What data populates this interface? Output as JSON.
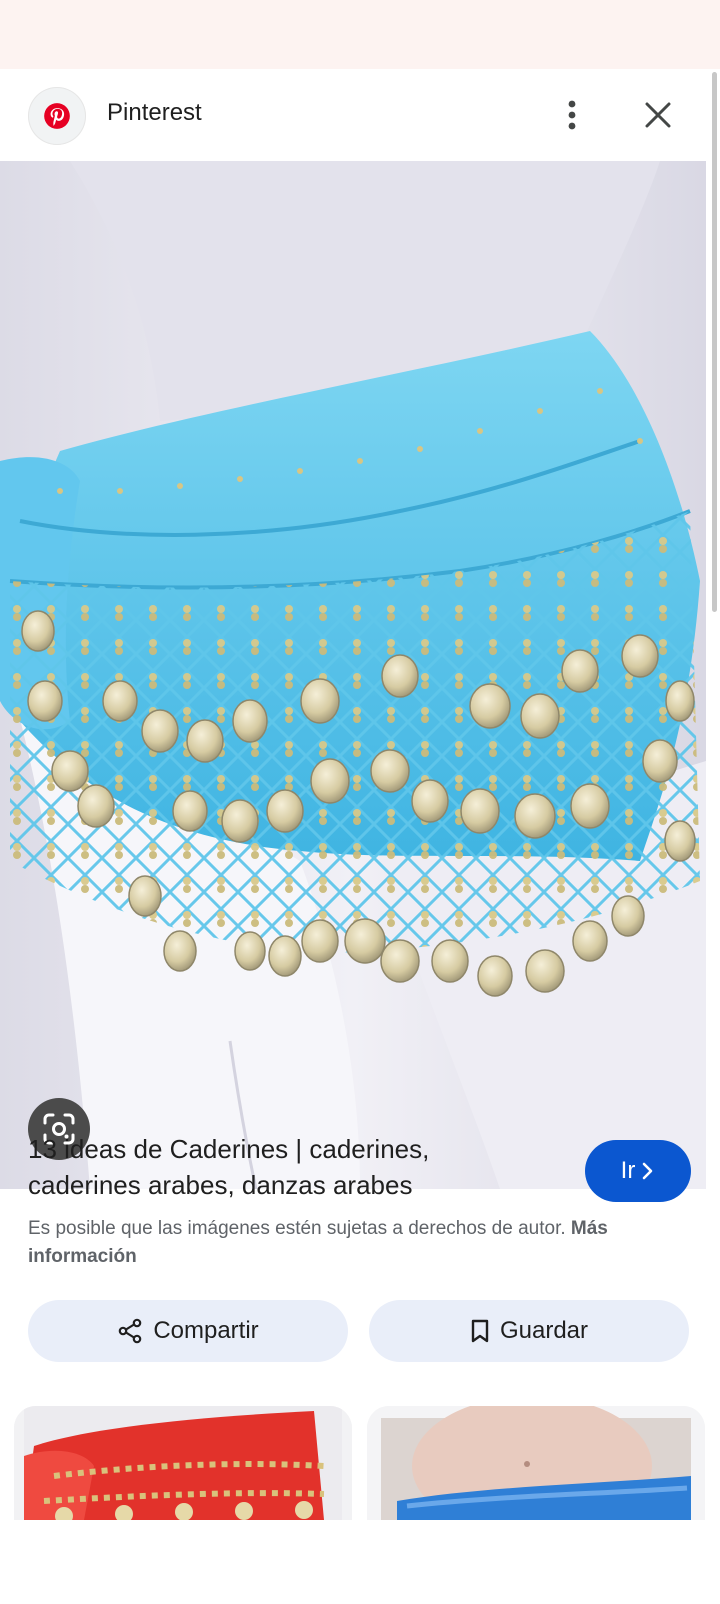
{
  "header": {
    "source_name": "Pinterest",
    "logo_icon": "pinterest-logo-icon",
    "menu_icon": "more-vert-icon",
    "close_icon": "close-icon"
  },
  "hero": {
    "lens_icon": "google-lens-icon"
  },
  "result": {
    "title": "13 ideas de Caderines | caderines, caderines arabes, danzas arabes",
    "go_label": "Ir",
    "notice_text": "Es posible que las imágenes estén sujetas a derechos de autor.",
    "notice_link": "Más información"
  },
  "actions": {
    "share_label": "Compartir",
    "save_label": "Guardar"
  },
  "colors": {
    "accent": "#0b57d0",
    "chip_bg": "#e9eef9",
    "pinterest_red": "#e60023"
  }
}
